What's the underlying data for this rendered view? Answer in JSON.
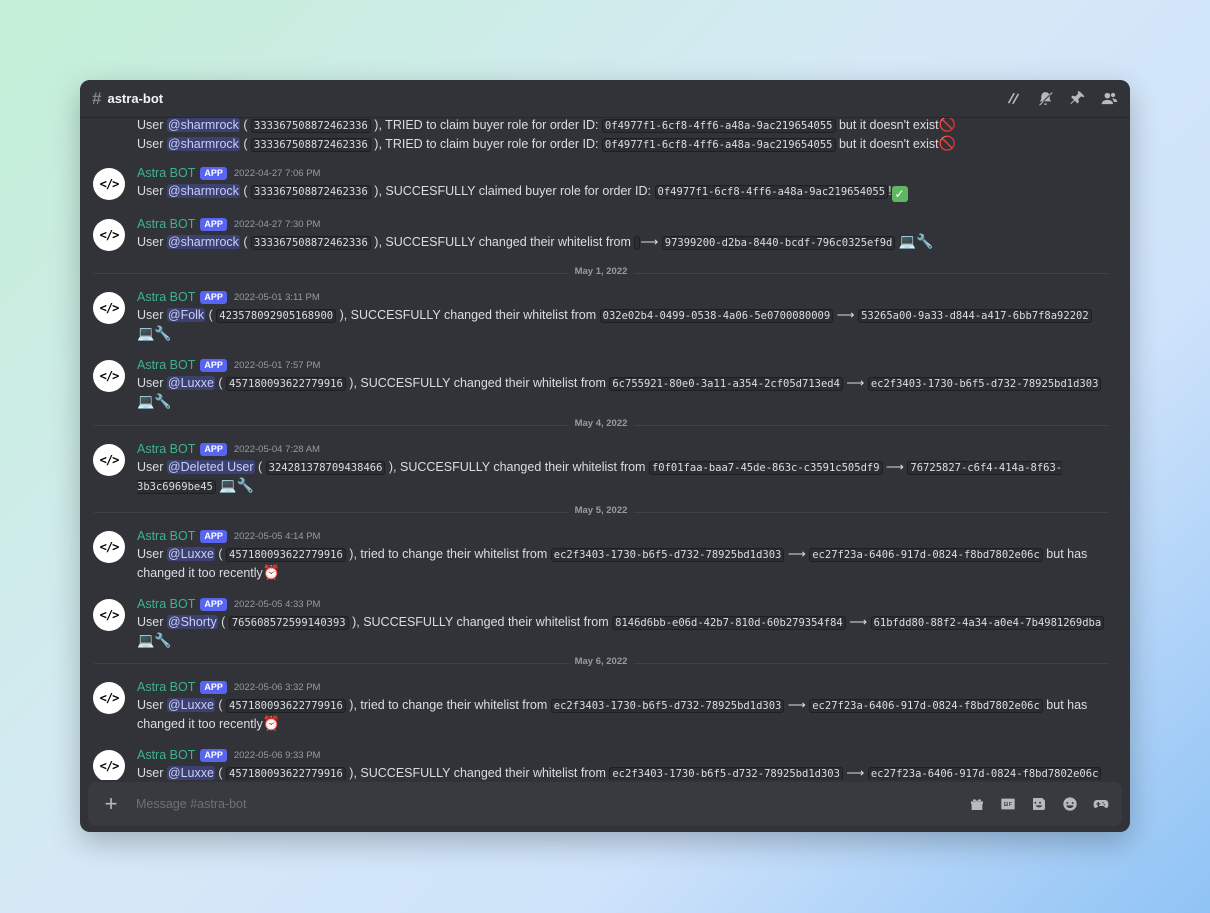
{
  "channel": {
    "icon": "hashtag-icon",
    "name": "astra-bot"
  },
  "header_icons": [
    "threads-icon",
    "mute-icon",
    "pin-icon",
    "members-icon"
  ],
  "colors": {
    "background": "#313338",
    "author": "#3fb28c",
    "app_badge": "#5865f2",
    "mention": "#c9cdfb"
  },
  "composer": {
    "placeholder": "Message #astra-bot",
    "icons": [
      "gift-icon",
      "gif-icon",
      "sticker-icon",
      "emoji-icon",
      "apps-icon"
    ]
  },
  "bot": {
    "avatar": "</>",
    "name": "Astra BOT",
    "badge": "APP"
  },
  "continuation": [
    {
      "p1": "User ",
      "mention": "@sharmrock",
      "p2": " ( ",
      "id": "333367508872462336",
      "p3": " ), TRIED to claim buyer role for order ID: ",
      "code1": "0f4977f1-6cf8-4ff6-a48a-9ac219654055",
      "p4": " but it doesn't exist",
      "emoji": "🚫"
    },
    {
      "p1": "User ",
      "mention": "@sharmrock",
      "p2": " ( ",
      "id": "333367508872462336",
      "p3": " ), TRIED to claim buyer role for order ID: ",
      "code1": "0f4977f1-6cf8-4ff6-a48a-9ac219654055",
      "p4": " but it doesn't exist",
      "emoji": "🚫"
    }
  ],
  "messages": [
    {
      "time": "2022-04-27 7:06 PM",
      "p1": "User ",
      "mention": "@sharmrock",
      "p2": " ( ",
      "id": "333367508872462336",
      "p3": " ), SUCCESFULLY claimed buyer role for order ID: ",
      "code1": "0f4977f1-6cf8-4ff6-a48a-9ac219654055",
      "p4": "!",
      "emoji": "✅"
    },
    {
      "time": "2022-04-27 7:30 PM",
      "p1": "User ",
      "mention": "@sharmrock",
      "p2": " ( ",
      "id": "333367508872462336",
      "p3": " ), SUCCESFULLY changed their whitelist from ",
      "code1": " ",
      "arrow": " ⟶ ",
      "code2": "97399200-d2ba-8440-bcdf-796c0325ef9d",
      "emoji": "💻🔧"
    },
    {
      "time": "2022-05-01 3:11 PM",
      "p1": "User ",
      "mention": "@Folk",
      "p2": " ( ",
      "id": "423578092905168900",
      "p3": " ), SUCCESFULLY changed their whitelist from ",
      "code1": "032e02b4-0499-0538-4a06-5e0700080009",
      "arrow": " ⟶ ",
      "code2": "53265a00-9a33-d844-a417-6bb7f8a92202",
      "emoji": "💻🔧"
    },
    {
      "time": "2022-05-01 7:57 PM",
      "p1": "User ",
      "mention": "@Luxxe",
      "p2": " ( ",
      "id": "457180093622779916",
      "p3": " ), SUCCESFULLY changed their whitelist from ",
      "code1": "6c755921-80e0-3a11-a354-2cf05d713ed4",
      "arrow": " ⟶ ",
      "code2": "ec2f3403-1730-b6f5-d732-78925bd1d303",
      "emoji": "💻🔧"
    },
    {
      "time": "2022-05-04 7:28 AM",
      "p1": "User ",
      "mention": "@Deleted User",
      "p2": " ( ",
      "id": "324281378709438466",
      "p3": " ), SUCCESFULLY changed their whitelist from ",
      "code1": "f0f01faa-baa7-45de-863c-c3591c505df9",
      "arrow": " ⟶ ",
      "code2": "76725827-c6f4-414a-8f63-3b3c6969be45",
      "emoji": "💻🔧"
    },
    {
      "time": "2022-05-05 4:14 PM",
      "p1": "User ",
      "mention": "@Luxxe",
      "p2": " ( ",
      "id": "457180093622779916",
      "p3": " ), tried to change their whitelist from ",
      "code1": "ec2f3403-1730-b6f5-d732-78925bd1d303",
      "arrow": " ⟶ ",
      "code2": "ec27f23a-6406-917d-0824-f8bd7802e06c",
      "p4": " but has changed it too recently",
      "emoji": "⏰"
    },
    {
      "time": "2022-05-05 4:33 PM",
      "p1": "User ",
      "mention": "@Shorty",
      "p2": " ( ",
      "id": "765608572599140393",
      "p3": " ), SUCCESFULLY changed their whitelist from ",
      "code1": "8146d6bb-e06d-42b7-810d-60b279354f84",
      "arrow": " ⟶ ",
      "code2": "61bfdd80-88f2-4a34-a0e4-7b4981269dba",
      "emoji": "💻🔧"
    },
    {
      "time": "2022-05-06 3:32 PM",
      "p1": "User ",
      "mention": "@Luxxe",
      "p2": " ( ",
      "id": "457180093622779916",
      "p3": " ), tried to change their whitelist from ",
      "code1": "ec2f3403-1730-b6f5-d732-78925bd1d303",
      "arrow": " ⟶ ",
      "code2": "ec27f23a-6406-917d-0824-f8bd7802e06c",
      "p4": " but has changed it too recently",
      "emoji": "⏰"
    },
    {
      "time": "2022-05-06 9:33 PM",
      "p1": "User ",
      "mention": "@Luxxe",
      "p2": " ( ",
      "id": "457180093622779916",
      "p3": " ), SUCCESFULLY changed their whitelist from ",
      "code1": "ec2f3403-1730-b6f5-d732-78925bd1d303",
      "arrow": " ⟶ ",
      "code2": "ec27f23a-6406-917d-0824-f8bd7802e06c",
      "emoji": "💻"
    }
  ],
  "dividers": [
    "May 1, 2022",
    "May 4, 2022",
    "May 5, 2022",
    "May 6, 2022"
  ]
}
